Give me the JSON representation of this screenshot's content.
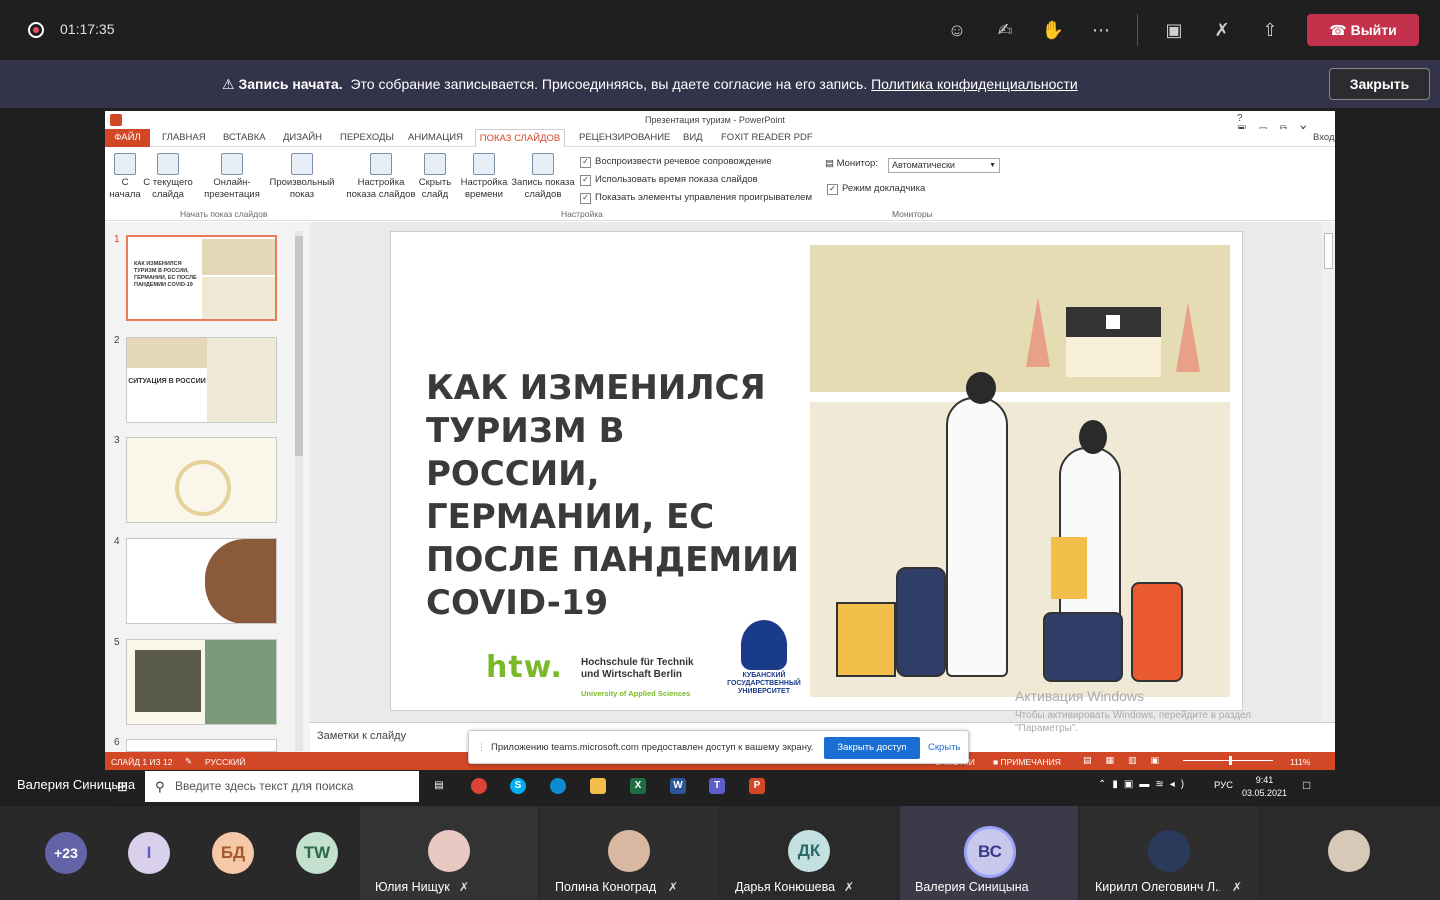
{
  "teams": {
    "timer": "01:17:35",
    "leave_label": "Выйти",
    "icons": [
      "participants-icon",
      "chat-icon",
      "reactions-icon",
      "more-icon",
      "camera-off-icon",
      "mic-off-icon",
      "share-icon",
      "phone-hangup-icon"
    ]
  },
  "banner": {
    "title": "Запись начата.",
    "message": "Это собрание записывается. Присоединяясь, вы даете согласие на его запись.",
    "link": "Политика конфиденциальности",
    "close_label": "Закрыть"
  },
  "ppt": {
    "window_title": "Презентация туризм - PowerPoint",
    "signin": "Вход",
    "tabs": [
      "ФАЙЛ",
      "ГЛАВНАЯ",
      "ВСТАВКА",
      "ДИЗАЙН",
      "ПЕРЕХОДЫ",
      "АНИМАЦИЯ",
      "ПОКАЗ СЛАЙДОВ",
      "РЕЦЕНЗИРОВАНИЕ",
      "ВИД",
      "FOXIT READER PDF"
    ],
    "ribbon": {
      "from_start": "С начала",
      "from_current": "С текущего слайда",
      "online": "Онлайн-презентация",
      "custom": "Произвольный показ",
      "group_start": "Начать показ слайдов",
      "setup": "Настройка показа слайдов",
      "hide": "Скрыть слайд",
      "rehearse": "Настройка времени",
      "record": "Запись показа слайдов",
      "group_setup": "Настройка",
      "chk1": "Воспроизвести речевое сопровождение",
      "chk2": "Использовать время показа слайдов",
      "chk3": "Показать элементы управления проигрывателем",
      "monitor_label": "Монитор:",
      "monitor_value": "Автоматически",
      "presenter_view": "Режим докладчика",
      "group_monitors": "Мониторы"
    },
    "slide_numbers": [
      "1",
      "2",
      "3",
      "4",
      "5",
      "6"
    ],
    "thumb1_title": "КАК ИЗМЕНИЛСЯ ТУРИЗМ В РОССИИ, ГЕРМАНИИ, ЕС ПОСЛЕ ПАНДЕМИИ COVID-19",
    "thumb2_title": "СИТУАЦИЯ В РОССИИ",
    "slide": {
      "title": "КАК ИЗМЕНИЛСЯ ТУРИЗМ В РОССИИ, ГЕРМАНИИ, ЕС ПОСЛЕ ПАНДЕМИИ COVID-19",
      "htw_logo": "htw.",
      "htw_name_line1": "Hochschule für Technik",
      "htw_name_line2": "und Wirtschaft Berlin",
      "htw_sub": "University of Applied Sciences",
      "kubgu": "КУБАНСКИЙ ГОСУДАРСТВЕННЫЙ УНИВЕРСИТЕТ"
    },
    "notes_label": "Заметки к слайду",
    "activation_title": "Активация Windows",
    "activation_sub": "Чтобы активировать Windows, перейдите в раздел \"Параметры\".",
    "status": {
      "slide_info": "СЛАЙД 1 ИЗ 12",
      "language": "РУССКИЙ",
      "notes": "ЗАМЕТКИ",
      "comments": "ПРИМЕЧАНИЯ",
      "zoom": "111%"
    }
  },
  "share_popup": {
    "text": "Приложению teams.microsoft.com предоставлен доступ к вашему экрану.",
    "stop_label": "Закрыть доступ",
    "hide_label": "Скрыть"
  },
  "taskbar": {
    "search_placeholder": "Введите здесь текст для поиска",
    "lang": "РУС",
    "time": "9:41",
    "date": "03.05.2021"
  },
  "presenter": "Валерия Синицына",
  "participants": {
    "overflow": "+23",
    "avatars": [
      {
        "initials": "I",
        "color": "#d9d1ec"
      },
      {
        "initials": "БД",
        "color": "#f5c8a8"
      },
      {
        "initials": "TW",
        "color": "#c4e0cf"
      }
    ],
    "tiles": [
      {
        "name": "Юлия Нищук",
        "initials": "",
        "color": "#e8c8c0"
      },
      {
        "name": "Полина Коноград",
        "initials": "",
        "color": "#d8b8a0"
      },
      {
        "name": "Дарья Конюшева",
        "initials": "ДК",
        "color": "#c4e0e0"
      },
      {
        "name": "Валерия Синицына",
        "initials": "ВС",
        "color": "#c8c8ec"
      },
      {
        "name": "Кирилл Олеговинч Л...",
        "initials": "",
        "color": "#2a3a5a"
      },
      {
        "name": "",
        "initials": "",
        "color": "#d8c8b8"
      }
    ]
  }
}
